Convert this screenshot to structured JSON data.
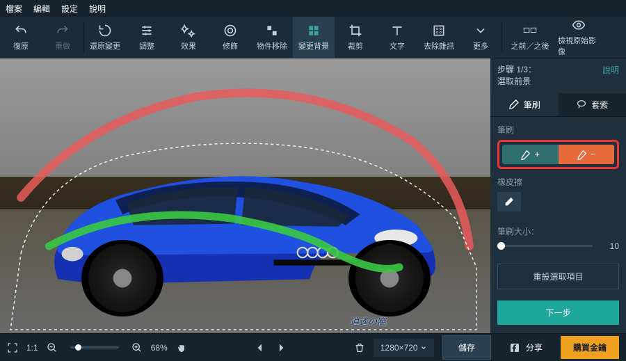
{
  "menu": {
    "file": "檔案",
    "edit": "編輯",
    "settings": "設定",
    "help": "說明"
  },
  "toolbar": {
    "undo": "復原",
    "redo": "重做",
    "revert": "還原變更",
    "adjust": "調整",
    "effects": "效果",
    "retouch": "修飾",
    "remove": "物件移除",
    "bg": "變更背景",
    "crop": "裁剪",
    "text": "文字",
    "denoise": "去除雜訊",
    "more": "更多",
    "beforeafter": "之前／之後",
    "original": "檢視原始影像"
  },
  "sidebar": {
    "step": "步驟 1/3：",
    "stepName": "選取前景",
    "help": "說明",
    "tabBrush": "筆刷",
    "tabLasso": "套索",
    "brushLabel": "筆刷",
    "eraserLabel": "橡皮擦",
    "sizeLabel": "筆刷大小：",
    "sizeVal": "10",
    "reset": "重設選取項目",
    "next": "下一步"
  },
  "status": {
    "ratio": "1:1",
    "zoom": "68%",
    "dims": "1280×720",
    "save": "儲存",
    "share": "分享",
    "buy": "購買金鑰"
  },
  "watermark": "逍遙の窩"
}
